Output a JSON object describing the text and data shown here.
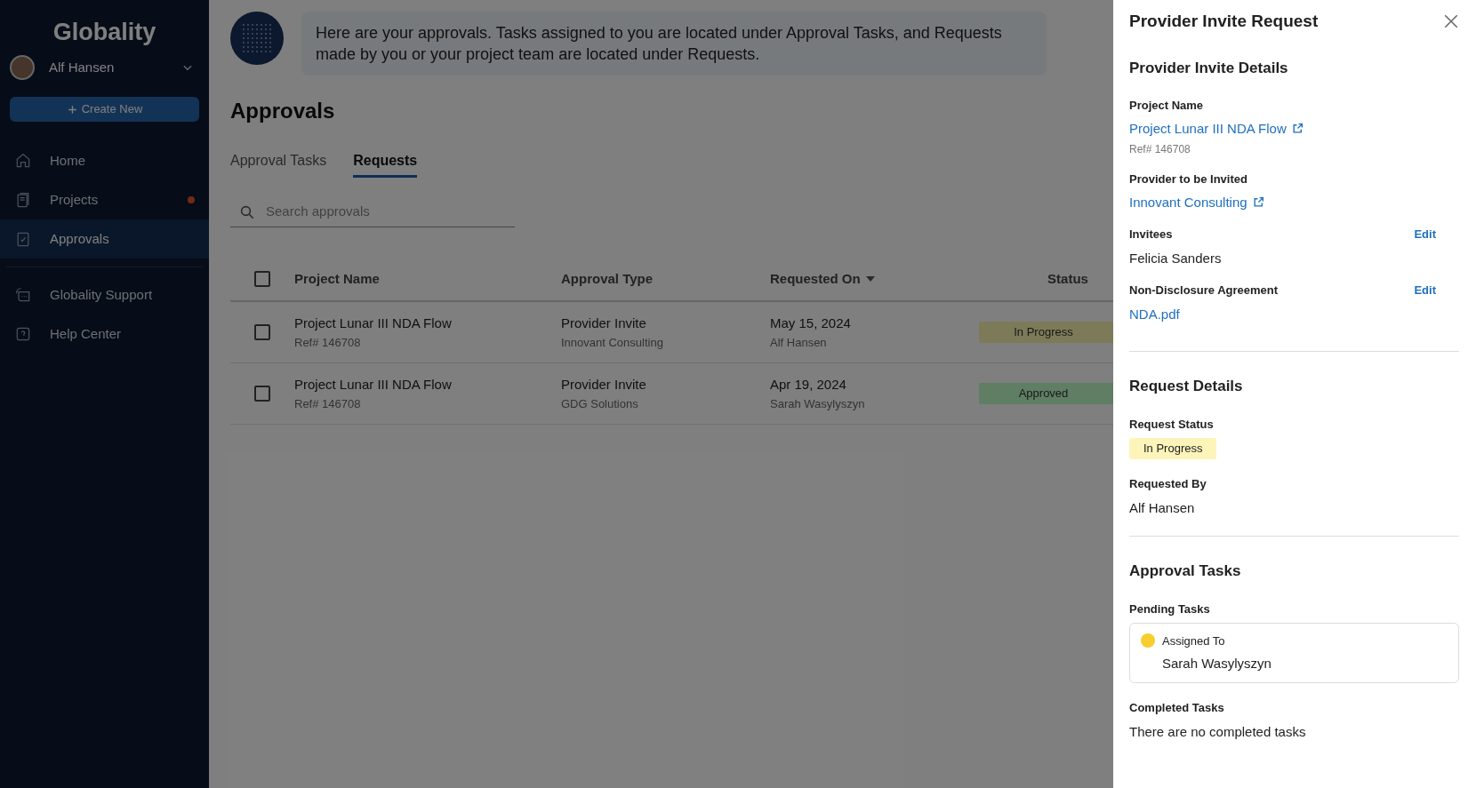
{
  "sidebar": {
    "logo": "Globality",
    "user": {
      "name": "Alf Hansen"
    },
    "create_button": "Create New",
    "nav_items": [
      {
        "label": "Home",
        "selected": false,
        "notification": false
      },
      {
        "label": "Projects",
        "selected": false,
        "notification": true
      },
      {
        "label": "Approvals",
        "selected": true,
        "notification": false
      }
    ],
    "help_items": [
      {
        "label": "Globality Support"
      },
      {
        "label": "Help Center"
      }
    ]
  },
  "main": {
    "assistant_message": "Here are your approvals. Tasks assigned to you are located under Approval Tasks, and Requests made by you or your project team are located under Requests.",
    "title": "Approvals",
    "tabs": [
      {
        "label": "Approval Tasks",
        "selected": false
      },
      {
        "label": "Requests",
        "selected": true
      }
    ],
    "search": {
      "placeholder": "Search approvals"
    },
    "table": {
      "select_all": {
        "checked": false
      },
      "columns": [
        {
          "label": "Project Name",
          "sorted": false
        },
        {
          "label": "Approval Type",
          "sorted": false
        },
        {
          "label": "Requested On",
          "sorted": true
        },
        {
          "label": "Status",
          "sorted": false
        }
      ],
      "rows": [
        {
          "checked": false,
          "project": "Project Lunar III NDA Flow",
          "ref": "Ref# 146708",
          "type": "Provider Invite",
          "provider": "Innovant Consulting",
          "date": "May 15, 2024",
          "requester": "Alf Hansen",
          "status": {
            "label": "In Progress",
            "color": "#7d7a58"
          }
        },
        {
          "checked": false,
          "project": "Project Lunar III NDA Flow",
          "ref": "Ref# 146708",
          "type": "Provider Invite",
          "provider": "GDG Solutions",
          "date": "Apr 19, 2024",
          "requester": "Sarah Wasylyszyn",
          "status": {
            "label": "Approved",
            "color": "#5f7e64"
          }
        }
      ]
    }
  },
  "panel": {
    "title": "Provider Invite Request",
    "invite_details": {
      "heading": "Provider Invite Details",
      "project_name": {
        "label": "Project Name",
        "value": "Project Lunar III NDA Flow",
        "ref": "Ref# 146708"
      },
      "provider": {
        "label": "Provider to be Invited",
        "value": "Innovant Consulting"
      },
      "invitees": {
        "label": "Invitees",
        "edit": "Edit",
        "value": "Felicia Sanders"
      },
      "nda": {
        "label": "Non-Disclosure Agreement",
        "edit": "Edit",
        "value": "NDA.pdf"
      }
    },
    "request_details": {
      "heading": "Request Details",
      "status": {
        "label": "Request Status",
        "value": "In Progress",
        "color": "#fcf4b9"
      },
      "requested_by": {
        "label": "Requested By",
        "value": "Alf Hansen"
      }
    },
    "approval_tasks": {
      "heading": "Approval Tasks",
      "pending_label": "Pending Tasks",
      "pending": [
        {
          "label": "Assigned To",
          "assignee": "Sarah Wasylyszyn",
          "color": "#f7ce2e"
        }
      ],
      "completed_label": "Completed Tasks",
      "completed_empty": "There are no completed tasks"
    }
  }
}
